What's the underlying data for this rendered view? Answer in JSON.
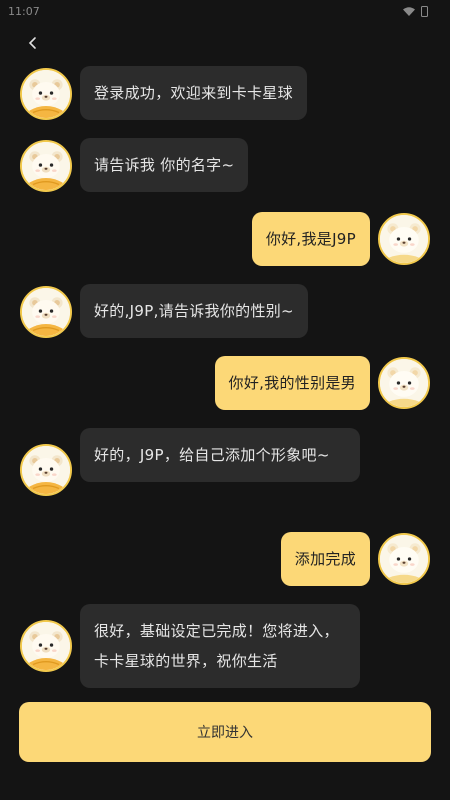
{
  "status_bar": {
    "time": "11:07"
  },
  "messages": [
    {
      "sender": "bot",
      "text": "登录成功，欢迎来到卡卡星球"
    },
    {
      "sender": "bot",
      "text": "请告诉我  你的名字~"
    },
    {
      "sender": "user",
      "text": "你好,我是J9P"
    },
    {
      "sender": "bot",
      "text": "好的,J9P,请告诉我你的性别~"
    },
    {
      "sender": "user",
      "text": "你好,我的性别是男"
    },
    {
      "sender": "bot",
      "text": "好的，J9P，给自己添加个形象吧~"
    },
    {
      "sender": "user",
      "text": "添加完成"
    },
    {
      "sender": "bot",
      "text": "很好，基础设定已完成！您将进入，卡卡星球的世界，祝你生活"
    }
  ],
  "enter_button": {
    "label": "立即进入"
  },
  "colors": {
    "accent": "#fcd877",
    "bot_bubble": "#2c2c2c",
    "background": "#141414"
  },
  "icons": {
    "back": "chevron-left-icon",
    "wifi": "wifi-icon",
    "battery": "battery-icon",
    "avatar": "bear-avatar-icon"
  }
}
